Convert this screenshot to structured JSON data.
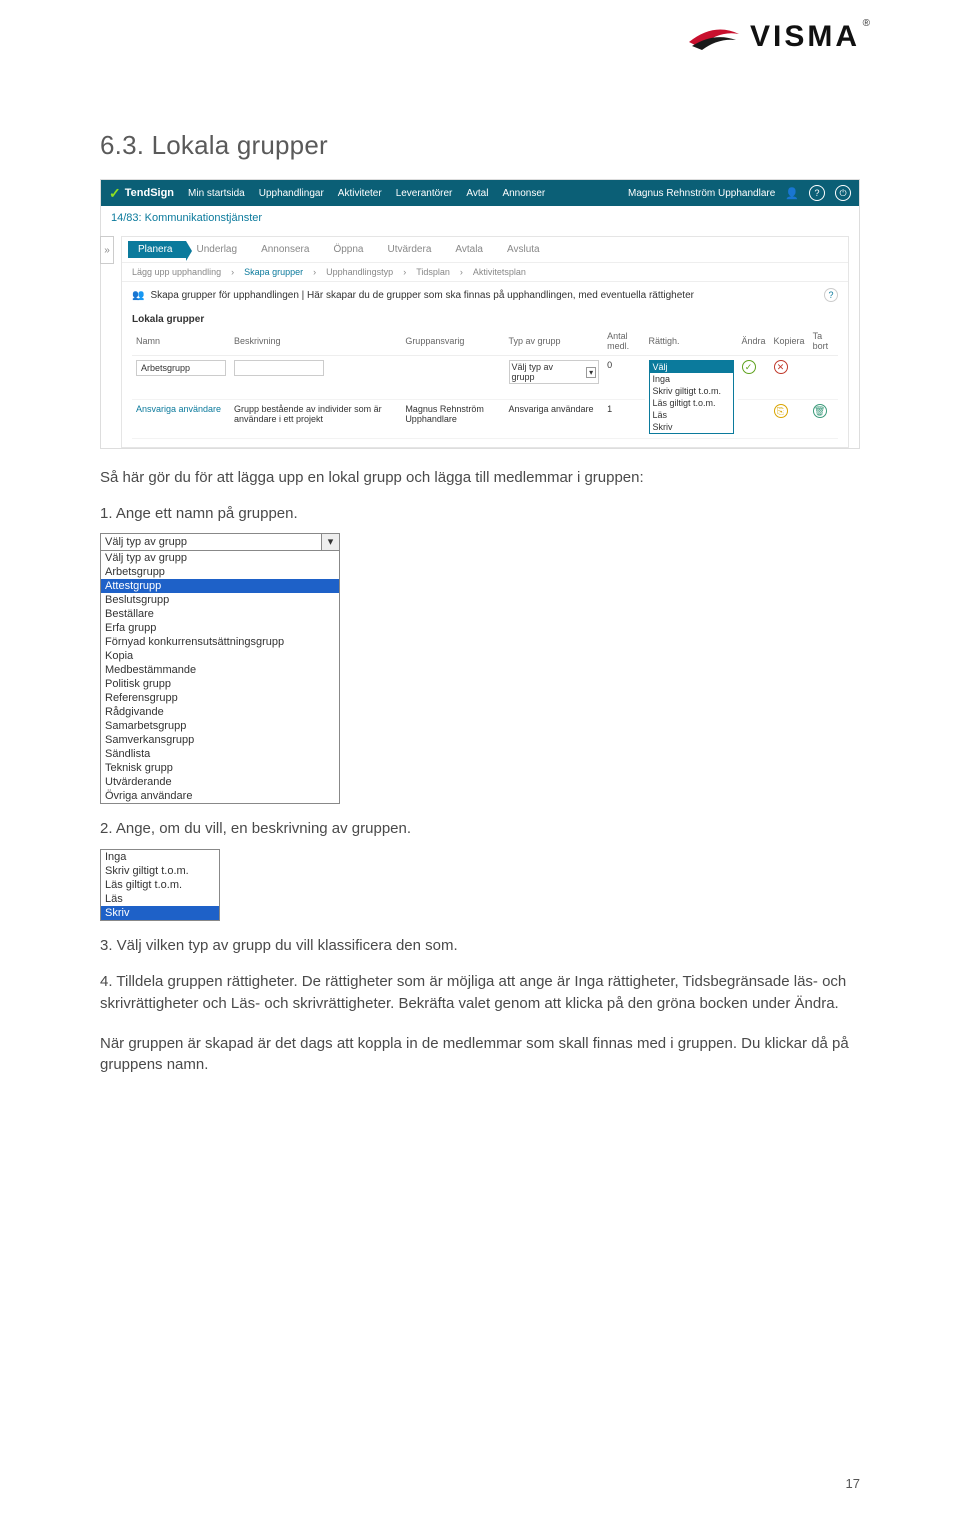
{
  "logo_text": "VISMA",
  "section_title": "6.3.   Lokala grupper",
  "app": {
    "brand": "TendSign",
    "nav": [
      "Min startsida",
      "Upphandlingar",
      "Aktiviteter",
      "Leverantörer",
      "Avtal",
      "Annonser"
    ],
    "user": "Magnus Rehnström Upphandlare",
    "breadcrumb": "14/83: Kommunikationstjänster",
    "wizard": [
      "Planera",
      "Underlag",
      "Annonsera",
      "Öppna",
      "Utvärdera",
      "Avtala",
      "Avsluta"
    ],
    "subnav": [
      "Lägg upp upphandling",
      "Skapa grupper",
      "Upphandlingstyp",
      "Tidsplan",
      "Aktivitetsplan"
    ],
    "info": "Skapa grupper för upphandlingen  |  Här skapar du de grupper som ska finnas på upphandlingen, med eventuella rättigheter",
    "table_title": "Lokala grupper",
    "headers": [
      "Namn",
      "Beskrivning",
      "Gruppansvarig",
      "Typ av grupp",
      "Antal medl.",
      "Rättigh.",
      "Ändra",
      "Kopiera",
      "Ta bort"
    ],
    "row1": {
      "name": "Arbetsgrupp",
      "typ": "Välj typ av grupp",
      "antal": "0"
    },
    "row2": {
      "name": "Ansvariga användare",
      "desc": "Grupp bestående av individer som är användare i ett projekt",
      "ansvarig": "Magnus Rehnström Upphandlare",
      "typ": "Ansvariga användare",
      "antal": "1"
    },
    "rights_opts": [
      "Välj",
      "Inga",
      "Skriv giltigt t.o.m.",
      "Läs giltigt t.o.m.",
      "Läs",
      "Skriv"
    ]
  },
  "intro": "Så här gör du för att lägga upp en lokal grupp och lägga till medlemmar i gruppen:",
  "steps": {
    "s1": "1. Ange ett namn på gruppen.",
    "s2": "2. Ange, om du vill, en beskrivning av gruppen.",
    "s3": "3. Välj vilken typ av grupp du vill klassificera den som.",
    "s4": "4. Tilldela gruppen rättigheter. De rättigheter som är möjliga att ange är Inga rättigheter, Tidsbegränsade läs- och skrivrättigheter och Läs- och skrivrättigheter. Bekräfta valet genom att klicka på den gröna bocken under Ändra.",
    "final": "När gruppen är skapad är det dags att koppla in de medlemmar som skall finnas med i gruppen. Du klickar då på gruppens namn."
  },
  "dropdown": {
    "selected": "Välj typ av grupp",
    "options": [
      "Välj typ av grupp",
      "Arbetsgrupp",
      "Attestgrupp",
      "Beslutsgrupp",
      "Beställare",
      "Erfa grupp",
      "Förnyad konkurrensutsättningsgrupp",
      "Kopia",
      "Medbestämmande",
      "Politisk grupp",
      "Referensgrupp",
      "Rådgivande",
      "Samarbetsgrupp",
      "Samverkansgrupp",
      "Sändlista",
      "Teknisk grupp",
      "Utvärderande",
      "Övriga användare"
    ],
    "highlight_index": 2
  },
  "rights_list": {
    "options": [
      "Inga",
      "Skriv giltigt t.o.m.",
      "Läs giltigt t.o.m.",
      "Läs",
      "Skriv"
    ],
    "highlight_index": 4
  },
  "page_number": "17"
}
